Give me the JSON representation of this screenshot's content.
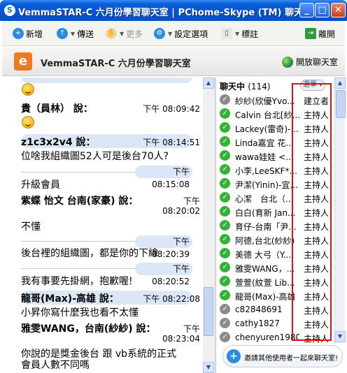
{
  "window": {
    "title": "VemmaSTAR-C 六月份學習聊天室 | PChome-Skype (TM) 聊天",
    "min_label": "_",
    "max_label": "□",
    "close_label": "✕"
  },
  "toolbar": {
    "add_label": "新增",
    "send_label": "傳送",
    "more_label": "更多",
    "settings_label": "設定選項",
    "bookmark_label": "標註",
    "leave_label": "離開"
  },
  "chat": {
    "logo_text": "e",
    "title": "VemmaSTAR-C 六月份學習聊天室",
    "open_label": "開放聊天室"
  },
  "messages": [
    {
      "name": "貴（員林） 說：",
      "time": "下午 08:09:42"
    },
    {
      "name": "z1c3x2v4 說：",
      "time": "下午 08:14:51",
      "text": "位啥我組織圖52人可是後台70人?"
    },
    {
      "time": "下午 08:15:08",
      "text": "升級會員"
    },
    {
      "name": "紫蝶 怡文 台南(家豪) 說：",
      "time_a": "下午",
      "time_b": "08:20:02",
      "text": "不懂"
    },
    {
      "time": "下午 08:20:39",
      "text": "後台裡的組織圖，都是你的下線"
    },
    {
      "time": "下午 08:20:52",
      "text": "我有事要先掛網，抱歉喔!"
    },
    {
      "name": "龍哥(Max)-高雄 說：",
      "time": "下午 08:22:08",
      "text": "小昇你寫什麼我也看不太懂"
    },
    {
      "name": "雅雯WANG，台南(紗紗) 說：",
      "time_a": "下午",
      "time_b": "08:23:04",
      "text": "你說的是獎金後台 跟 vb系統的正式",
      "text2": "會員人數不同嗎"
    }
  ],
  "people": {
    "header_label": "聊天中",
    "count": "(114)",
    "sort_label": "選單 ▾",
    "list": [
      {
        "name": "紗紗(欣優Yvo...",
        "role": "建立者",
        "status": "offline"
      },
      {
        "name": "Calvin 台北[紗...",
        "role": "主持人",
        "status": "online"
      },
      {
        "name": "Lackey(雷奇)-...",
        "role": "主持人",
        "status": "online"
      },
      {
        "name": "Linda嘉宜 花...",
        "role": "主持人",
        "status": "online"
      },
      {
        "name": "wawa娃娃 <...",
        "role": "主持人",
        "status": "online"
      },
      {
        "name": "小李,LeeSKF*...",
        "role": "主持人",
        "status": "online"
      },
      {
        "name": "尹潔(Yinin)-宜...",
        "role": "主持人",
        "status": "online"
      },
      {
        "name": "心潔　台北（...",
        "role": "主持人",
        "status": "online"
      },
      {
        "name": "白白(育新 Jan...",
        "role": "主持人",
        "status": "online"
      },
      {
        "name": "育仔-台南「尹...",
        "role": "主持人",
        "status": "online"
      },
      {
        "name": "阿德,台北(紗紗)",
        "role": "主持人",
        "status": "online"
      },
      {
        "name": "美德 大弓（Y...",
        "role": "主持人",
        "status": "online"
      },
      {
        "name": "雅雯WANG，...",
        "role": "主持人",
        "status": "online"
      },
      {
        "name": "萱萱(紋萱 Lib...",
        "role": "主持人",
        "status": "online"
      },
      {
        "name": "龍哥(Max)-高雄",
        "role": "主持人",
        "status": "online"
      },
      {
        "name": "c82848691",
        "role": "主持人",
        "status": "offline"
      },
      {
        "name": "cathy1827",
        "role": "主持人",
        "status": "offline"
      },
      {
        "name": "chenyuren1980",
        "role": "主持人",
        "status": "offline"
      }
    ]
  },
  "invite_label": "邀請其他使用者一起來聊天室!",
  "colors": {
    "titlebar": "#0553d0",
    "accent": "#dbe6f6",
    "highlight": "#e01010",
    "online": "#34b233",
    "offline": "#8a8a8a"
  }
}
